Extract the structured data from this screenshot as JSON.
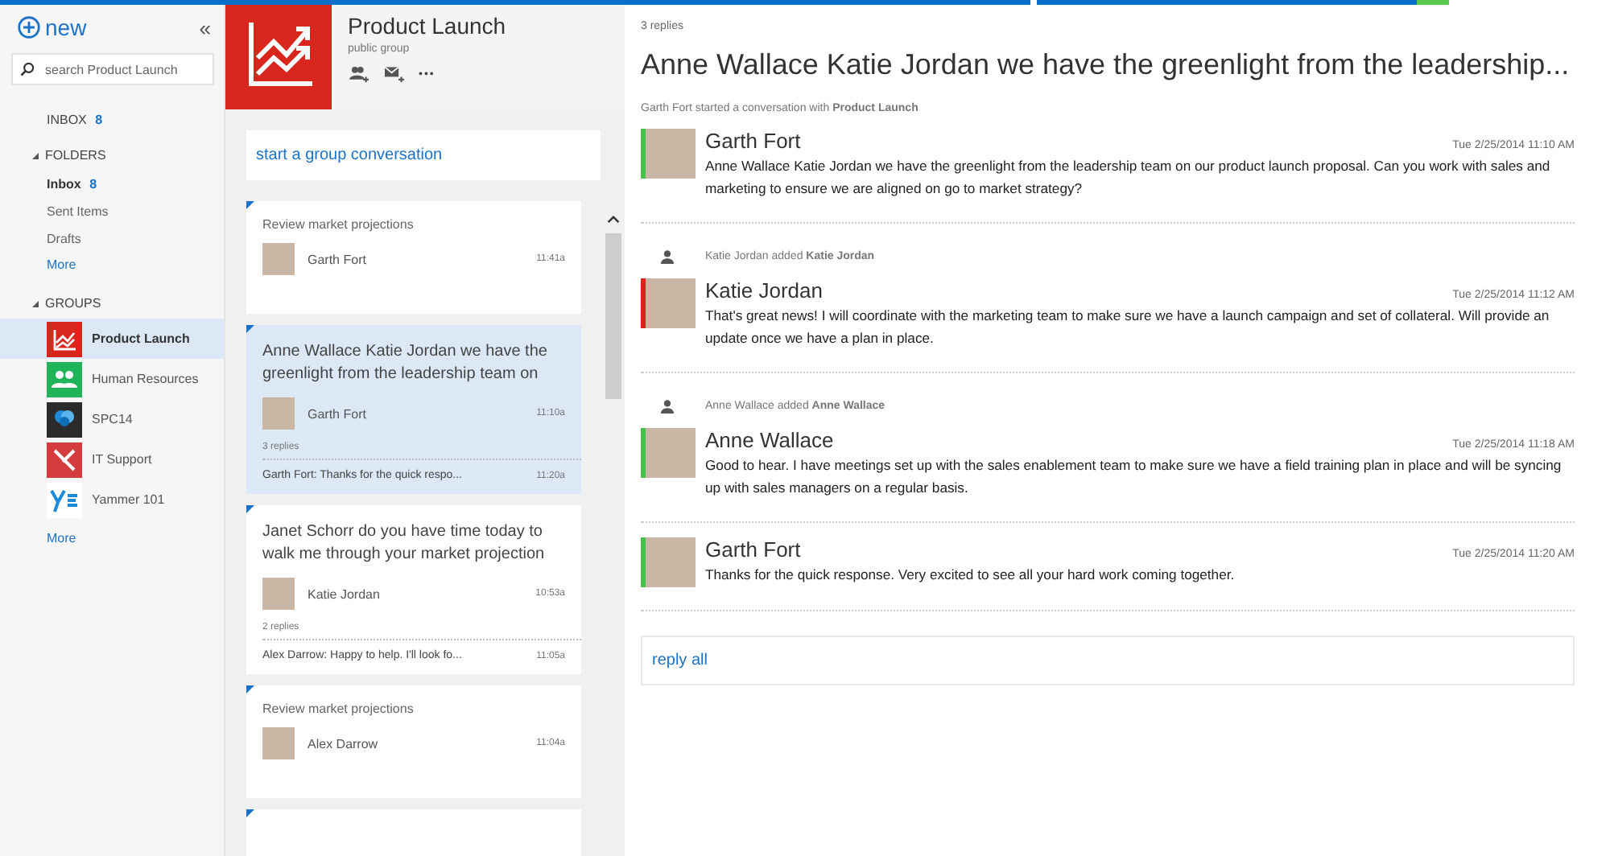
{
  "sidebar": {
    "new_label": "new",
    "collapse": "«",
    "search": {
      "placeholder": "search Product Launch"
    },
    "inbox": {
      "label": "INBOX",
      "count": "8"
    },
    "folders": {
      "label": "FOLDERS",
      "expanded": true,
      "items": [
        {
          "label": "Inbox",
          "count": "8",
          "selected": true
        },
        {
          "label": "Sent Items",
          "selected": false
        },
        {
          "label": "Drafts",
          "selected": false
        }
      ],
      "more": "More"
    },
    "groups": {
      "label": "GROUPS",
      "expanded": true,
      "items": [
        {
          "label": "Product Launch",
          "color": "#d9261c",
          "selected": true
        },
        {
          "label": "Human Resources",
          "color": "#1fb45a",
          "selected": false
        },
        {
          "label": "SPC14",
          "color": "#2b2b2b",
          "selected": false
        },
        {
          "label": "IT Support",
          "color": "#d53a3f",
          "selected": false
        },
        {
          "label": "Yammer 101",
          "color": "#ffffff",
          "selected": false
        }
      ],
      "more": "More"
    }
  },
  "group_header": {
    "title": "Product Launch",
    "subtitle": "public group",
    "more": "•••"
  },
  "conversations": {
    "compose": "start a group conversation",
    "items": [
      {
        "kind": "short",
        "title": "Review market projections",
        "author": "Garth Fort",
        "time": "11:41a",
        "unread": true,
        "selected": false
      },
      {
        "kind": "long",
        "title": "Anne Wallace Katie Jordan we have the greenlight from the leadership team on",
        "author": "Garth Fort",
        "time": "11:10a",
        "replies": "3 replies",
        "last_reply": "Garth Fort: Thanks for the quick respo...",
        "last_time": "11:20a",
        "unread": true,
        "selected": true
      },
      {
        "kind": "long",
        "title": "Janet Schorr do you have time today to walk me through your market projection",
        "author": "Katie Jordan",
        "time": "10:53a",
        "replies": "2 replies",
        "last_reply": "Alex Darrow: Happy to help. I'll look fo...",
        "last_time": "11:05a",
        "unread": true,
        "selected": false
      },
      {
        "kind": "short",
        "title": "Review market projections",
        "author": "Alex Darrow",
        "time": "11:04a",
        "unread": true,
        "selected": false
      },
      {
        "unread": true,
        "selected": false
      }
    ]
  },
  "thread": {
    "replies": "3 replies",
    "title": "Anne Wallace Katie Jordan we have the greenlight from the leadership...",
    "started": "Garth Fort started a conversation with **Product Launch**",
    "items": [
      {
        "kind": "message",
        "author": "Garth Fort",
        "time": "Tue 2/25/2014 11:10 AM",
        "color": "#4cc04c",
        "body": "Anne Wallace Katie Jordan we have the greenlight from the leadership team on our product launch proposal. Can you work with sales and marketing to ensure we are aligned on go to market strategy?"
      },
      {
        "kind": "event",
        "text": "Katie Jordan added **Katie Jordan**"
      },
      {
        "kind": "message",
        "author": "Katie Jordan",
        "time": "Tue 2/25/2014 11:12 AM",
        "color": "#d9261c",
        "body": "That's great news! I will coordinate with the marketing team to make sure we have a launch campaign and set of collateral. Will provide an update once we have a plan in place."
      },
      {
        "kind": "event",
        "text": "Anne Wallace added **Anne Wallace**"
      },
      {
        "kind": "message",
        "author": "Anne Wallace",
        "time": "Tue 2/25/2014 11:18 AM",
        "color": "#4cc04c",
        "body": "Good to hear. I have meetings set up with the sales enablement team to make sure we have a field training plan in place and will be syncing up with sales managers on a regular basis."
      },
      {
        "kind": "message",
        "author": "Garth Fort",
        "time": "Tue 2/25/2014 11:20 AM",
        "color": "#4cc04c",
        "body": "Thanks for the quick response. Very excited to see all your hard work coming together."
      }
    ],
    "reply": "reply all"
  }
}
